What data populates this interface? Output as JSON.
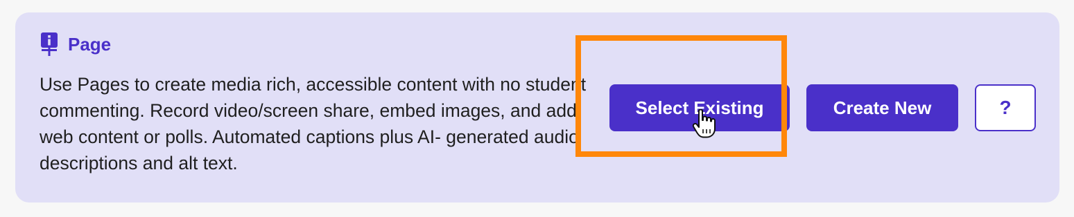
{
  "card": {
    "icon": "pin-board-icon",
    "title": "Page",
    "description": "Use Pages to create media rich, accessible content with no student commenting. Record video/screen share, embed images, and add web content or polls. Automated captions plus AI- generated audio descriptions and alt text."
  },
  "actions": {
    "select_existing_label": "Select Existing",
    "create_new_label": "Create New",
    "help_label": "?"
  },
  "overlay": {
    "highlight_color": "#ff870a",
    "cursor_icon": "hand-pointer-icon"
  },
  "colors": {
    "accent": "#4a30c9",
    "card_background": "#e1dff7",
    "page_background": "#f7f7f7"
  }
}
